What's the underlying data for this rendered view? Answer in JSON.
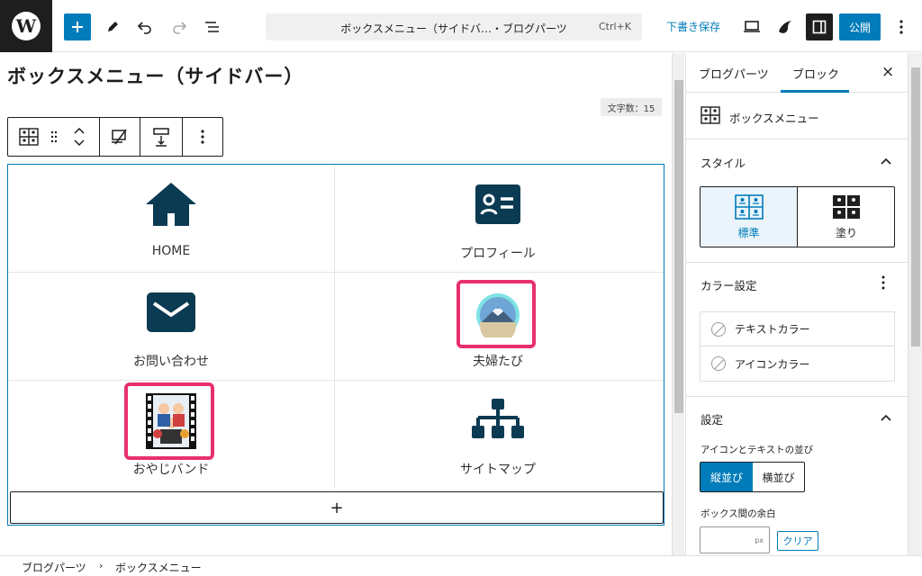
{
  "topbar": {
    "logo": "W",
    "add_icon": "plus-icon",
    "doc_title": "ボックスメニュー（サイドバ…・ブログパーツ",
    "doc_shortcut": "Ctrl+K",
    "save_draft": "下書き保存",
    "publish": "公開"
  },
  "editor": {
    "post_title": "ボックスメニュー（サイドバー）",
    "word_count": "文字数：15"
  },
  "box_menu": {
    "items": [
      {
        "label": "HOME",
        "icon": "home-icon"
      },
      {
        "label": "プロフィール",
        "icon": "profile-card-icon"
      },
      {
        "label": "お問い合わせ",
        "icon": "mail-icon"
      },
      {
        "label": "夫婦たび",
        "icon": "mount-fuji-image"
      },
      {
        "label": "おやじバンド",
        "icon": "band-illustration-image"
      },
      {
        "label": "サイトマップ",
        "icon": "sitemap-icon"
      }
    ],
    "appender": "+"
  },
  "sidebar": {
    "tabs": [
      "ブログパーツ",
      "ブロック"
    ],
    "active_tab": "ブロック",
    "close": "×",
    "block_name": "ボックスメニュー",
    "style_section": "スタイル",
    "styles": [
      "標準",
      "塗り"
    ],
    "color_section": "カラー設定",
    "colors": [
      "テキストカラー",
      "アイコンカラー"
    ],
    "settings_section": "設定",
    "layout_label": "アイコンとテキストの並び",
    "layout_options": [
      "縦並び",
      "横並び"
    ],
    "spacing_label": "ボックス間の余白",
    "spacing_unit": "px",
    "clear": "クリア"
  },
  "breadcrumb": [
    "ブログパーツ",
    "ボックスメニュー"
  ],
  "colors": {
    "accent": "#007cba",
    "icon_navy": "#0b3a53",
    "highlight_pink": "#e8306c"
  }
}
